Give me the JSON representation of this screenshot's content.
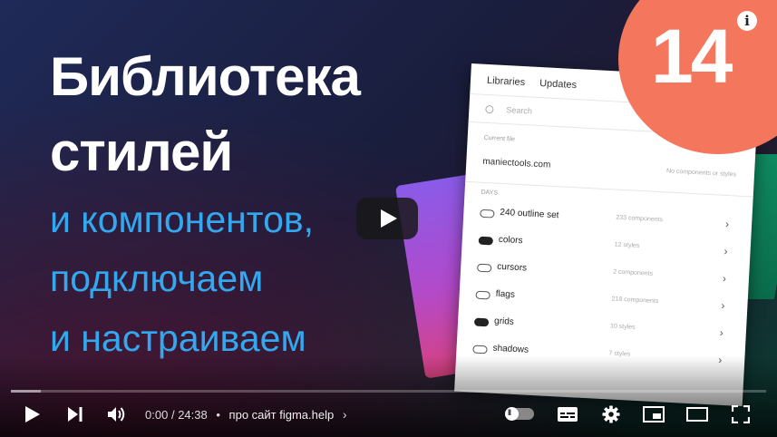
{
  "video": {
    "title_line1": "Библиотека",
    "title_line2": "стилей",
    "subtitle_line1": "и компонентов,",
    "subtitle_line2": "подключаем",
    "subtitle_line3": "и настраиваем",
    "badge_number": "14",
    "info_label": "i"
  },
  "panel": {
    "tabs": [
      "Libraries",
      "Updates"
    ],
    "search_placeholder": "Search",
    "current_file_label": "Current file",
    "current_file_name": "maniectools.com",
    "current_file_note": "No components or styles",
    "section_label": "DAYS",
    "rows": [
      {
        "name": "240 outline set",
        "count": "233 components",
        "on": false
      },
      {
        "name": "colors",
        "count": "12 styles",
        "on": true
      },
      {
        "name": "cursors",
        "count": "2 components",
        "on": false
      },
      {
        "name": "flags",
        "count": "218 components",
        "on": false
      },
      {
        "name": "grids",
        "count": "10 styles",
        "on": true
      },
      {
        "name": "shadows",
        "count": "7 styles",
        "on": false
      }
    ]
  },
  "controls": {
    "time_current": "0:00",
    "time_total": "24:38",
    "time_separator": "/",
    "dot": "•",
    "chapter": "про сайт figma.help",
    "chapter_arrow": "›",
    "progress_played": 0.0,
    "progress_buffered": 0.04
  },
  "colors": {
    "accent_red": "#ff0000",
    "title_white": "#ffffff",
    "subtitle_blue": "#34a8ef",
    "badge_coral": "#f4775d"
  },
  "icons": [
    "play-icon",
    "next-icon",
    "volume-icon",
    "autoplay-toggle",
    "subtitles-icon",
    "settings-icon",
    "miniplayer-icon",
    "theater-icon",
    "fullscreen-icon",
    "info-icon",
    "search-icon",
    "chevron-right-icon"
  ]
}
